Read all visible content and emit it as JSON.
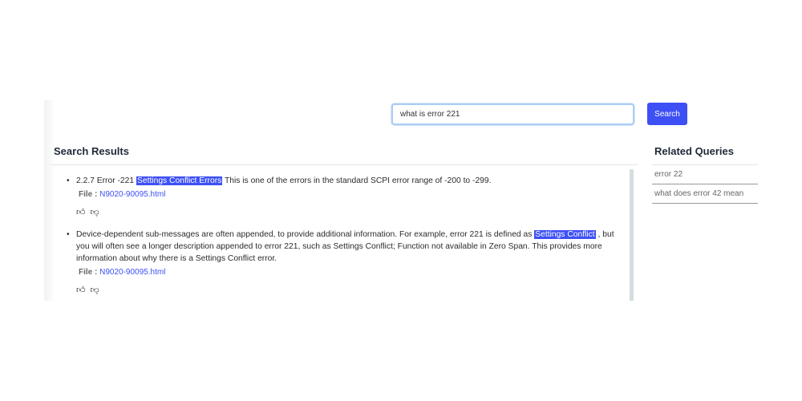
{
  "search": {
    "value": "what is error 221",
    "button_label": "Search"
  },
  "results": {
    "title": "Search Results",
    "file_label": "File :",
    "items": [
      {
        "pre": "2.2.7 Error -221 ",
        "highlight": "Settings Conflict Errors",
        "post": " This is one of the errors in the standard SCPI error range of -200 to -299.",
        "file": "N9020-90095.html"
      },
      {
        "pre": "Device-dependent sub-messages are often appended, to provide additional information. For example, error 221 is defined as ",
        "highlight": "Settings Conflict",
        "post": " , but you will often see a longer description appended to error 221, such as Settings Conflict; Function not available in Zero Span. This provides more information about why there is a Settings Conflict error.",
        "file": "N9020-90095.html"
      }
    ]
  },
  "related": {
    "title": "Related Queries",
    "items": [
      "error 22",
      "what does error 42 mean"
    ]
  },
  "colors": {
    "accent": "#3d50f5"
  }
}
